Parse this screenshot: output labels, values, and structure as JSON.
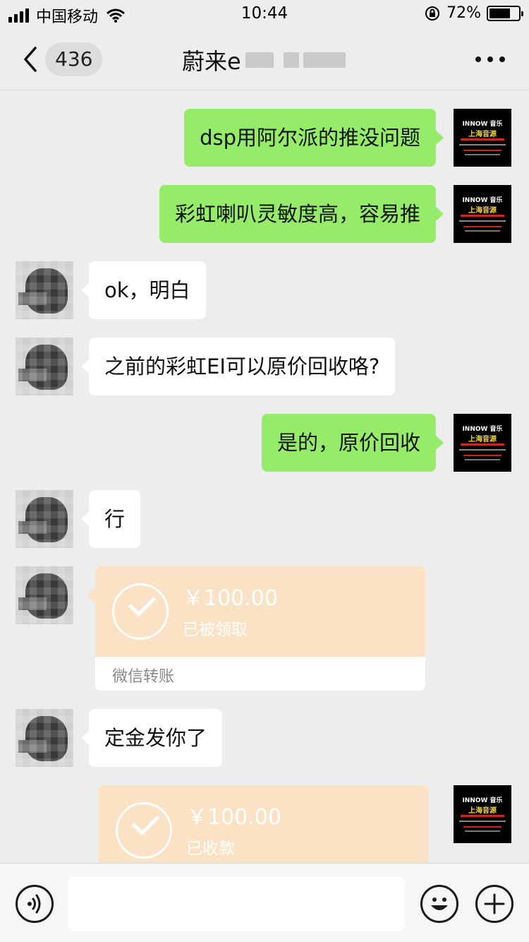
{
  "status_bar": {
    "carrier": "中国移动",
    "time": "10:44",
    "battery_percent": "72%",
    "battery_level": 0.72
  },
  "nav": {
    "unread_count": "436",
    "title": "蔚来e"
  },
  "messages": [
    {
      "side": "right",
      "type": "text",
      "text": "dsp用阿尔派的推没问题"
    },
    {
      "side": "right",
      "type": "text",
      "text": "彩虹喇叭灵敏度高，容易推"
    },
    {
      "side": "left",
      "type": "text",
      "text": "ok，明白"
    },
    {
      "side": "left",
      "type": "text",
      "text": "之前的彩虹EI可以原价回收咯?"
    },
    {
      "side": "right",
      "type": "text",
      "text": "是的，原价回收"
    },
    {
      "side": "left",
      "type": "text",
      "text": "行"
    },
    {
      "side": "left",
      "type": "transfer",
      "amount": "￥100.00",
      "status": "已被领取",
      "footer": "微信转账"
    },
    {
      "side": "left",
      "type": "text",
      "text": "定金发你了"
    },
    {
      "side": "right",
      "type": "transfer",
      "amount": "￥100.00",
      "status": "已收款"
    }
  ],
  "avatar_logo": {
    "line1": "INNOW 音乐",
    "line2": "上海音源"
  },
  "input_bar": {
    "placeholder": ""
  },
  "colors": {
    "background": "#ededed",
    "green_bubble": "#95ec69",
    "transfer_orange": "#fce2c4"
  }
}
